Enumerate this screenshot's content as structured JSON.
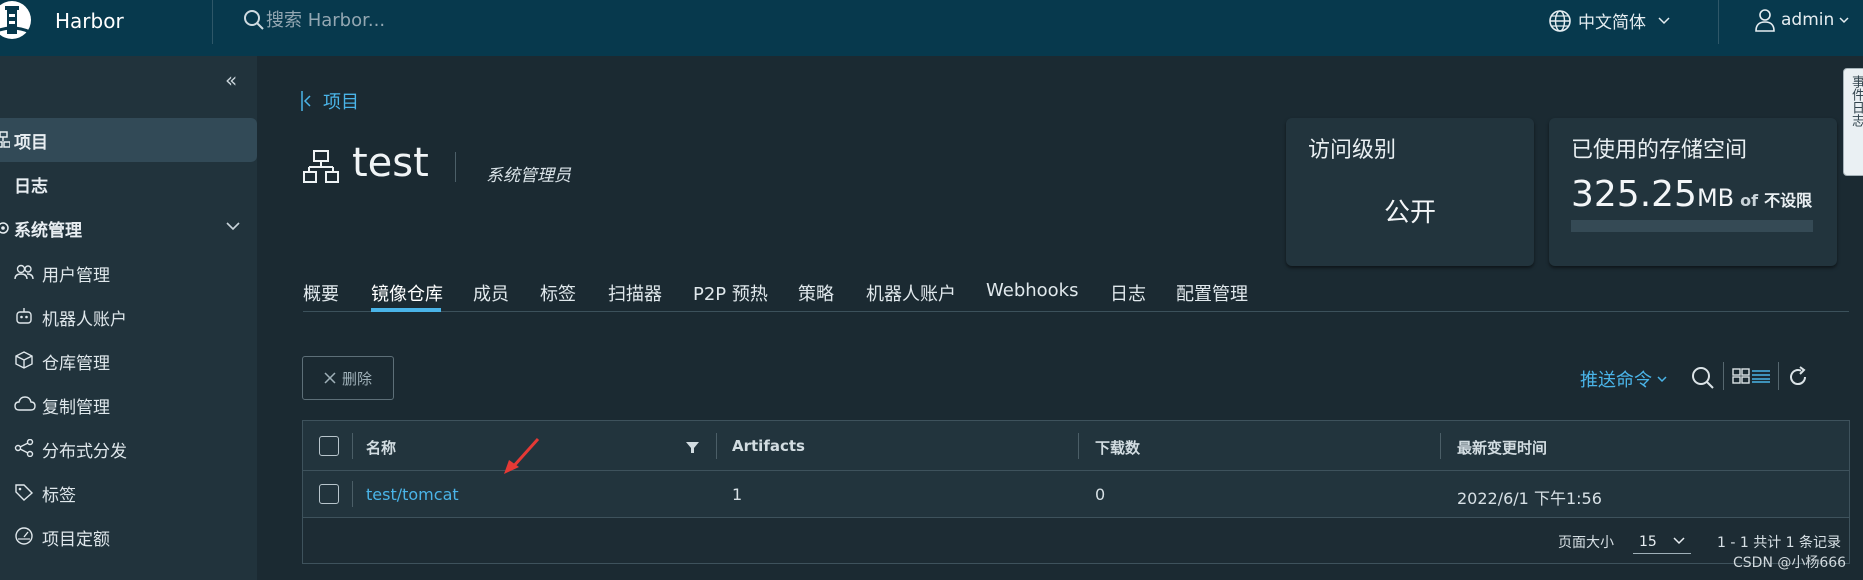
{
  "header": {
    "brand": "Harbor",
    "search_placeholder": "搜索 Harbor...",
    "language": "中文简体",
    "user": "admin"
  },
  "sidebar": {
    "items": [
      {
        "label": "项目",
        "icon": "project-icon"
      },
      {
        "label": "日志",
        "icon": "logs-icon"
      },
      {
        "label": "系统管理",
        "icon": "admin-icon"
      }
    ],
    "sub_items": [
      {
        "label": "用户管理",
        "icon": "users-icon"
      },
      {
        "label": "机器人账户",
        "icon": "robot-icon"
      },
      {
        "label": "仓库管理",
        "icon": "box-icon"
      },
      {
        "label": "复制管理",
        "icon": "cloud-icon"
      },
      {
        "label": "分布式分发",
        "icon": "share-icon"
      },
      {
        "label": "标签",
        "icon": "tag-icon"
      },
      {
        "label": "项目定额",
        "icon": "dashboard-icon"
      }
    ]
  },
  "breadcrumb": {
    "back_label": "项目"
  },
  "project": {
    "name": "test",
    "role": "系统管理员"
  },
  "cards": {
    "access": {
      "title": "访问级别",
      "value": "公开"
    },
    "storage": {
      "title": "已使用的存储空间",
      "value": "325.25",
      "unit": "MB",
      "of": "of",
      "limit": "不设限"
    }
  },
  "tabs": [
    "概要",
    "镜像仓库",
    "成员",
    "标签",
    "扫描器",
    "P2P 预热",
    "策略",
    "机器人账户",
    "Webhooks",
    "日志",
    "配置管理"
  ],
  "toolbar": {
    "delete_label": "删除",
    "push_command": "推送命令"
  },
  "table": {
    "columns": [
      "名称",
      "Artifacts",
      "下载数",
      "最新变更时间"
    ],
    "rows": [
      {
        "name": "test/tomcat",
        "artifacts": "1",
        "pulls": "0",
        "updated": "2022/6/1 下午1:56"
      }
    ],
    "footer": {
      "page_size_label": "页面大小",
      "page_size": "15",
      "count": "1 - 1 共计 1 条记录"
    }
  },
  "watermark": "CSDN @小杨666",
  "side_tab": "事件日志",
  "colors": {
    "header": "#07394d",
    "sidebar": "#21333c",
    "accent": "#4ab4e8",
    "background": "#1b2a32"
  }
}
